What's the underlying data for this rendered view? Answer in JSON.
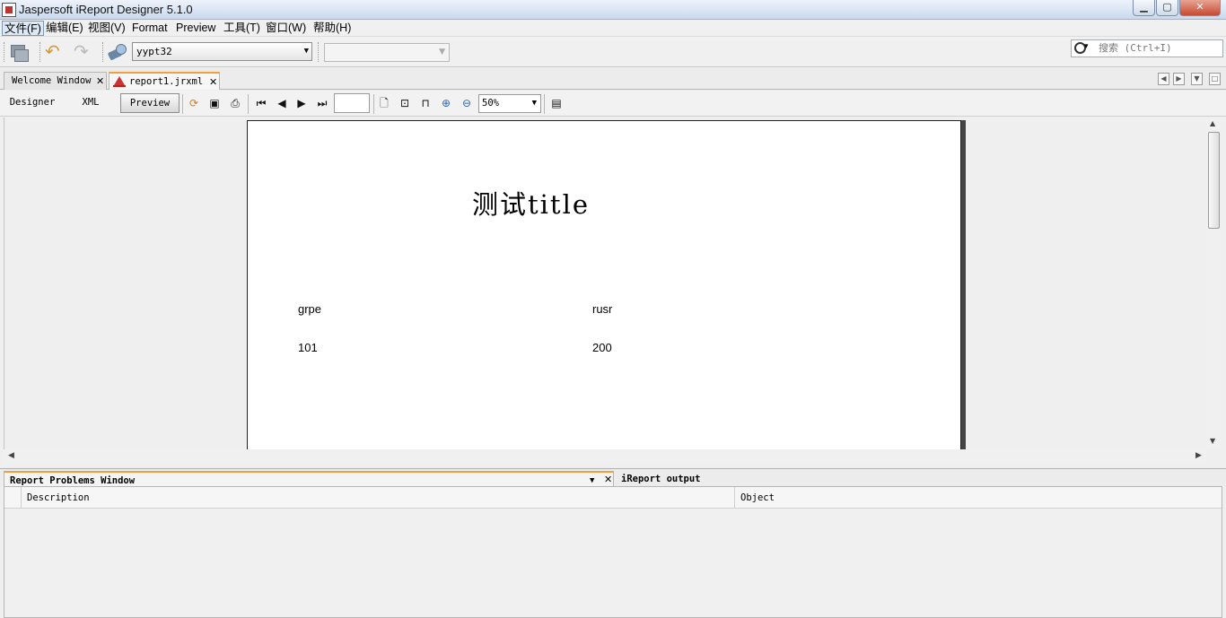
{
  "window": {
    "title": "Jaspersoft iReport Designer 5.1.0"
  },
  "menu": {
    "items": [
      "文件(F)",
      "编辑(E)",
      "视图(V)",
      "Format",
      "Preview",
      "工具(T)",
      "窗口(W)",
      "帮助(H)"
    ]
  },
  "toolbar": {
    "datasource_value": "yypt32",
    "search_placeholder": "搜索 (Ctrl+I)"
  },
  "tabs": {
    "welcome": "Welcome Window",
    "report": "report1.jrxml"
  },
  "view_toolbar": {
    "designer": "Designer",
    "xml": "XML",
    "preview": "Preview",
    "page_number": "",
    "zoom": "50%"
  },
  "report": {
    "title": "测试title",
    "headers": [
      "grpe",
      "rusr"
    ],
    "row": [
      "101",
      "200"
    ]
  },
  "bottom": {
    "problems_tab": "Report Problems Window",
    "output_tab": "iReport output",
    "columns": [
      "Description",
      "Object"
    ]
  },
  "colors": {
    "accent_tab": "#f0a040",
    "close_button": "#c74a31"
  }
}
